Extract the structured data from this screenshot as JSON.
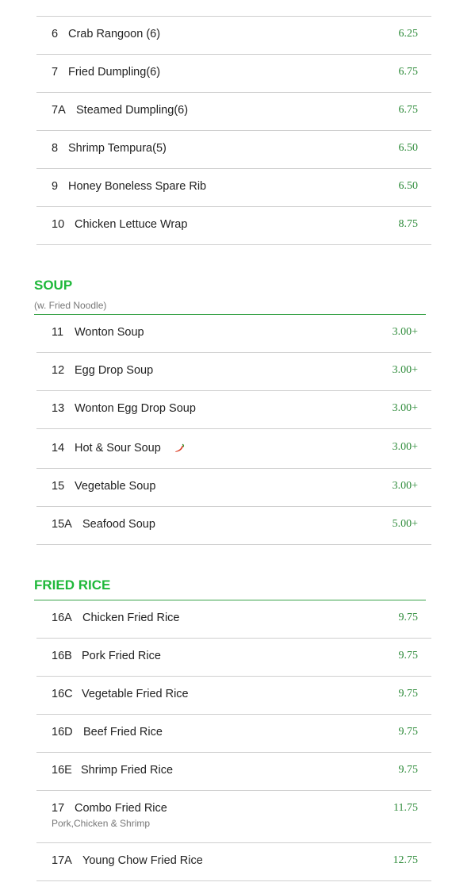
{
  "appetizers_tail": [
    {
      "num": "6",
      "name": "Crab Rangoon (6)",
      "price": "6.25"
    },
    {
      "num": "7",
      "name": "Fried Dumpling(6)",
      "price": "6.75"
    },
    {
      "num": "7A",
      "name": "Steamed Dumpling(6)",
      "price": "6.75"
    },
    {
      "num": "8",
      "name": "Shrimp Tempura(5)",
      "price": "6.50"
    },
    {
      "num": "9",
      "name": "Honey Boneless Spare Rib",
      "price": "6.50"
    },
    {
      "num": "10",
      "name": "Chicken Lettuce Wrap",
      "price": "8.75"
    }
  ],
  "soup": {
    "title": "SOUP",
    "subtitle": "(w. Fried Noodle)",
    "items": [
      {
        "num": "11",
        "name": "Wonton Soup",
        "price": "3.00+"
      },
      {
        "num": "12",
        "name": "Egg Drop Soup",
        "price": "3.00+"
      },
      {
        "num": "13",
        "name": "Wonton Egg Drop Soup",
        "price": "3.00+"
      },
      {
        "num": "14",
        "name": "Hot & Sour Soup",
        "price": "3.00+",
        "icon": "chili-pepper-icon"
      },
      {
        "num": "15",
        "name": "Vegetable Soup",
        "price": "3.00+"
      },
      {
        "num": "15A",
        "name": "Seafood Soup",
        "price": "5.00+"
      }
    ]
  },
  "fried_rice": {
    "title": "FRIED RICE",
    "items": [
      {
        "num": "16A",
        "name": "Chicken Fried Rice",
        "price": "9.75"
      },
      {
        "num": "16B",
        "name": "Pork Fried Rice",
        "price": "9.75"
      },
      {
        "num": "16C",
        "name": "Vegetable Fried Rice",
        "price": "9.75"
      },
      {
        "num": "16D",
        "name": "Beef Fried Rice",
        "price": "9.75"
      },
      {
        "num": "16E",
        "name": "Shrimp Fried Rice",
        "price": "9.75"
      },
      {
        "num": "17",
        "name": "Combo Fried Rice",
        "desc": "Pork,Chicken & Shrimp",
        "price": "11.75"
      },
      {
        "num": "17A",
        "name": "Young Chow Fried Rice",
        "price": "12.75"
      }
    ]
  },
  "colors": {
    "section_title": "#1fb83a",
    "price": "#2e8b3a",
    "rule": "#3aa34a",
    "pepper": "#d9361c"
  }
}
